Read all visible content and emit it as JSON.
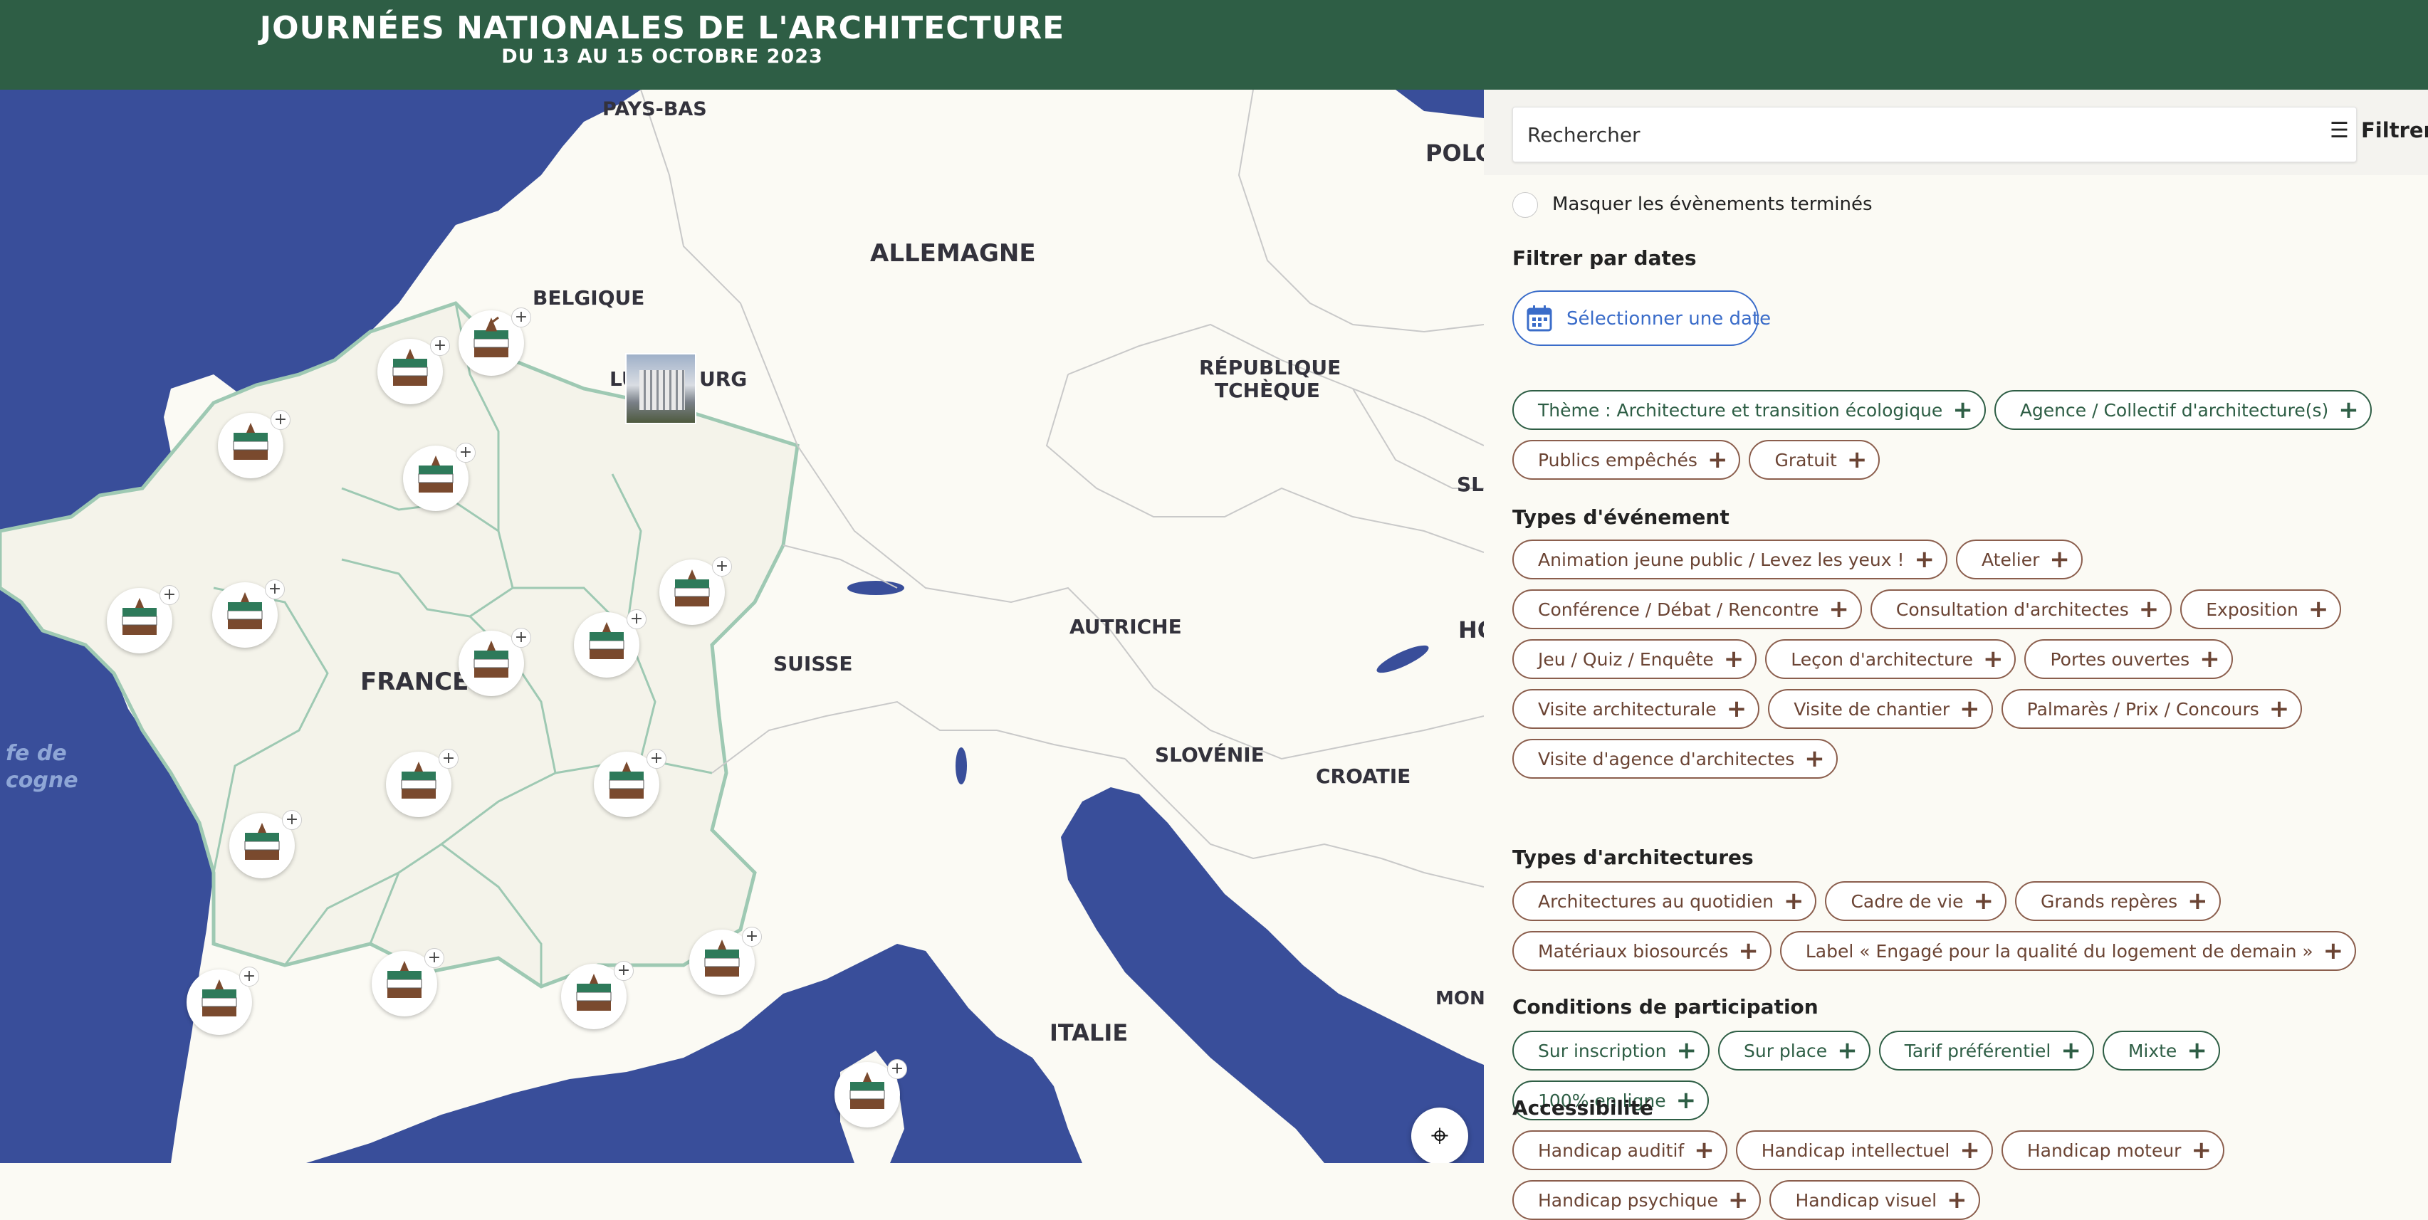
{
  "header": {
    "title": "JOURNÉES NATIONALES DE L'ARCHITECTURE",
    "subtitle": "DU 13 AU 15 OCTOBRE 2023"
  },
  "map": {
    "countries": {
      "pays_bas": "PAYS-BAS",
      "allemagne": "ALLEMAGNE",
      "pologne": "POLO",
      "belgique": "BELGIQUE",
      "luxembourg_left": "LU",
      "luxembourg_right": "URG",
      "republique_tcheque_1": "RÉPUBLIQUE",
      "republique_tcheque_2": "TCHÈQUE",
      "slovaquie": "SLO",
      "france": "FRANCE",
      "suisse": "SUISSE",
      "autriche": "AUTRICHE",
      "hongrie": "HO",
      "slovenie": "SLOVÉNIE",
      "croatie": "CROATIE",
      "italie": "ITALIE",
      "montenegro": "MONT"
    },
    "sea_label_1": "fe de",
    "sea_label_2": "cogne",
    "marker_icon": "architecture-event-icon",
    "locate_icon": "crosshair-icon",
    "colors": {
      "sea": "#394e9a",
      "land": "#fbfaf4",
      "border": "#9ec9b3"
    }
  },
  "sidebar": {
    "search_placeholder": "Rechercher",
    "filter_label": "Filtrer",
    "hide_finished_label": "Masquer les évènements terminés",
    "dates_title": "Filtrer par dates",
    "date_button_label": "Sélectionner une date",
    "top_chips": [
      "Thème : Architecture et transition écologique",
      "Agence / Collectif d'architecture(s)",
      "Publics empêchés",
      "Gratuit"
    ],
    "event_types_title": "Types d'événement",
    "event_types": [
      "Animation jeune public / Levez les yeux !",
      "Atelier",
      "Conférence / Débat / Rencontre",
      "Consultation d'architectes",
      "Exposition",
      "Jeu / Quiz / Enquête",
      "Leçon d'architecture",
      "Portes ouvertes",
      "Visite architecturale",
      "Visite de chantier",
      "Palmarès / Prix / Concours",
      "Visite d'agence d'architectes"
    ],
    "architecture_types_title": "Types d'architectures",
    "architecture_types": [
      "Architectures au quotidien",
      "Cadre de vie",
      "Grands repères",
      "Matériaux biosourcés",
      "Label « Engagé pour la qualité du logement de demain »"
    ],
    "conditions_title": "Conditions de participation",
    "conditions": [
      "Sur inscription",
      "Sur place",
      "Tarif préférentiel",
      "Mixte",
      "100% en ligne"
    ],
    "accessibility_title": "Accessibilité",
    "accessibility": [
      "Handicap auditif",
      "Handicap intellectuel",
      "Handicap moteur",
      "Handicap psychique",
      "Handicap visuel"
    ],
    "colors": {
      "green": "#2e5e45",
      "brown": "#8b5e4d",
      "date_blue": "#3a6cc9"
    }
  }
}
